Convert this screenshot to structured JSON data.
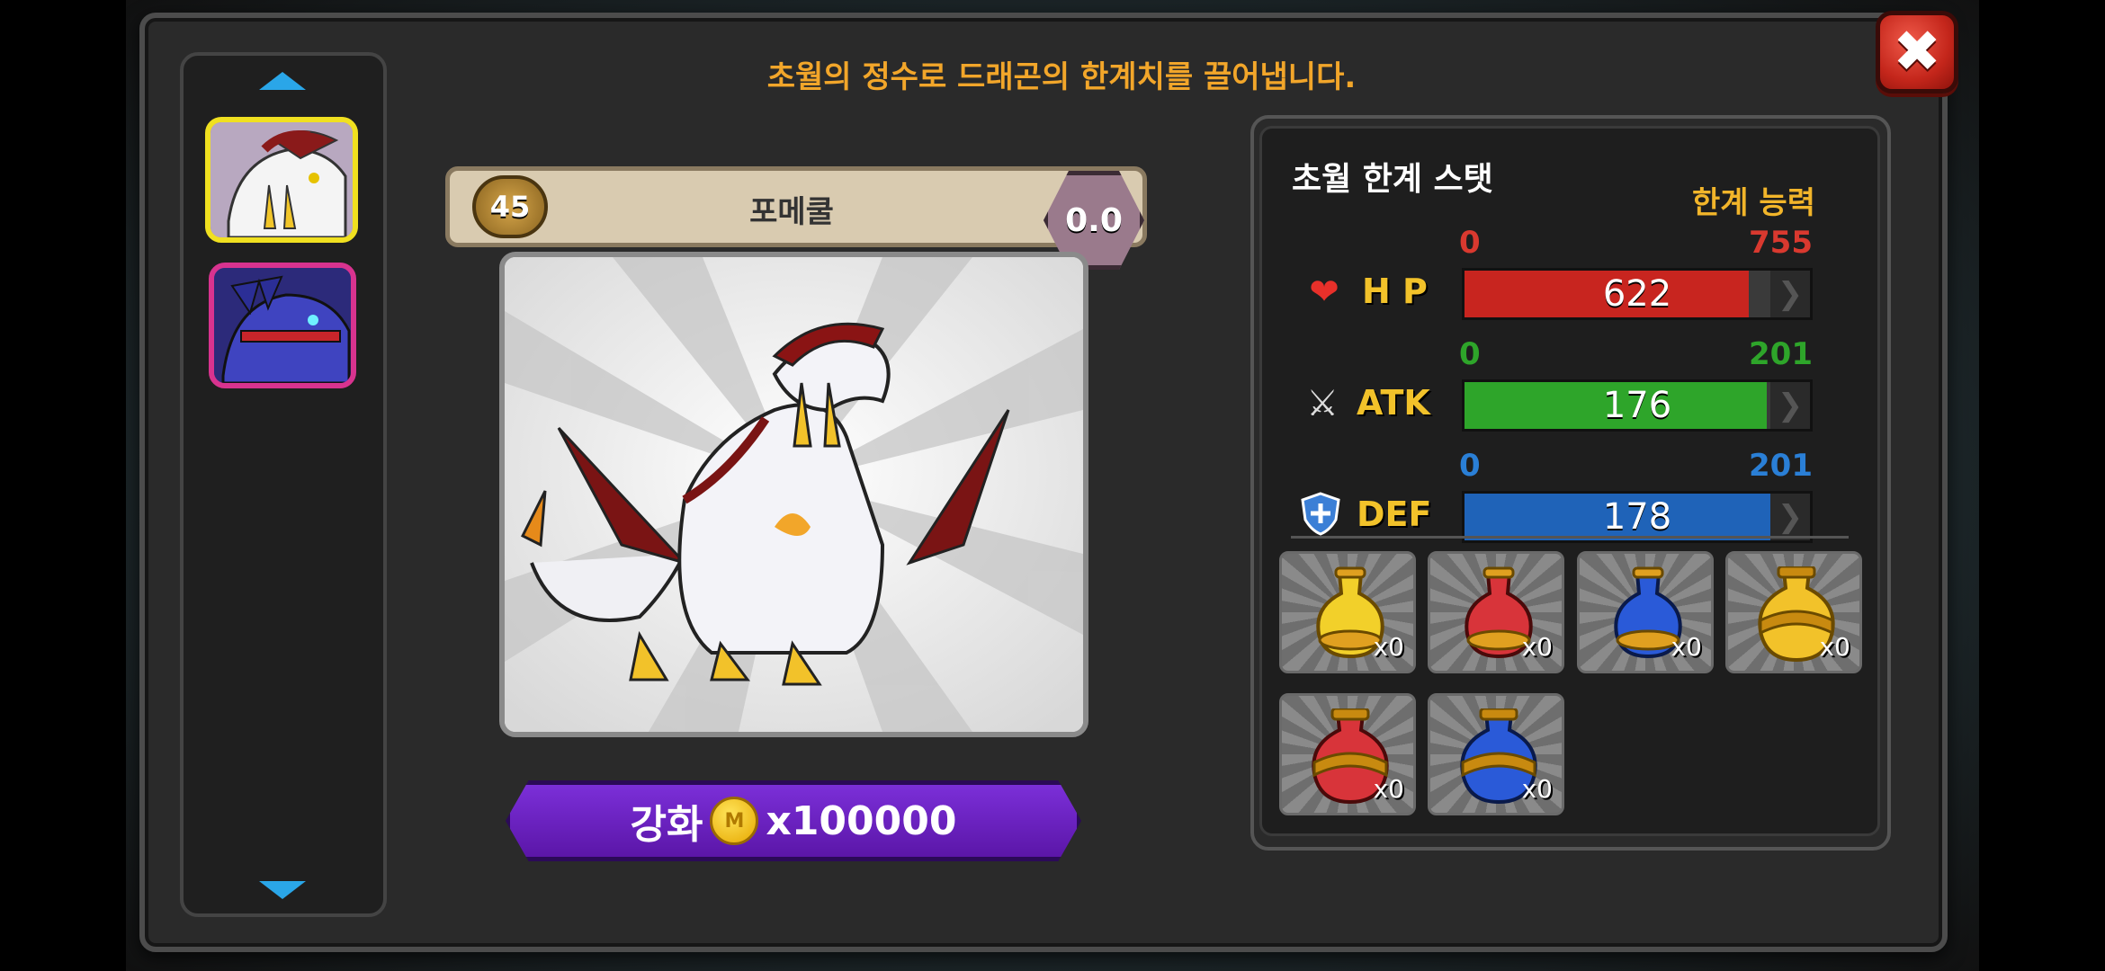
{
  "subtitle": "초월의 정수로 드래곤의 한계치를 끌어냅니다.",
  "close_icon": "close-icon",
  "sidebar": {
    "items": [
      {
        "name": "white-dragon-thumb",
        "selected": true
      },
      {
        "name": "blue-dragon-thumb",
        "selected": false
      }
    ]
  },
  "dragon": {
    "level": "45",
    "name": "포메쿨",
    "rating": "0.0"
  },
  "upgrade": {
    "label": "강화",
    "coin_label": "M",
    "cost": "x100000"
  },
  "stats": {
    "title": "초월 한계 스탯",
    "limit_label": "한계 능력",
    "hp": {
      "label": "H P",
      "min": "0",
      "max": "755",
      "value": "622",
      "fill": 0.824,
      "color": "#c8251f",
      "min_color": "#d9392f"
    },
    "atk": {
      "label": "ATK",
      "min": "0",
      "max": "201",
      "value": "176",
      "fill": 0.876,
      "color": "#2ea52a",
      "min_color": "#2ea52a"
    },
    "def": {
      "label": "DEF",
      "min": "0",
      "max": "201",
      "value": "178",
      "fill": 0.886,
      "color": "#1f63b8",
      "min_color": "#2a7fd6"
    }
  },
  "potions": [
    {
      "name": "yellow-potion",
      "color": "#f2d02a",
      "count": "x0"
    },
    {
      "name": "red-potion",
      "color": "#d8343a",
      "count": "x0"
    },
    {
      "name": "blue-potion",
      "color": "#2a5ad8",
      "count": "x0"
    },
    {
      "name": "big-yellow-potion",
      "color": "#f2c22a",
      "count": "x0"
    },
    {
      "name": "big-red-potion",
      "color": "#d8343a",
      "count": "x0"
    },
    {
      "name": "big-blue-potion",
      "color": "#2a5ad8",
      "count": "x0"
    }
  ]
}
